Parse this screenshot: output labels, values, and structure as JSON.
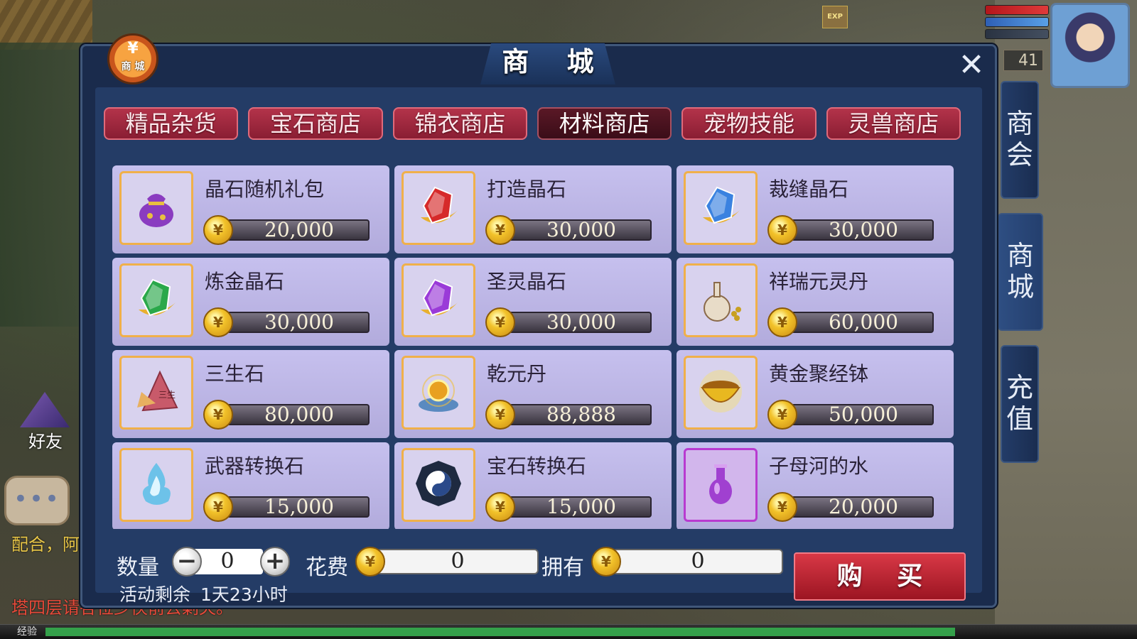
{
  "panel": {
    "title": "商 城",
    "badge_symbol": "¥",
    "badge_label": "商 城",
    "close_symbol": "✕"
  },
  "tabs": [
    {
      "label": "精品杂货",
      "active": false
    },
    {
      "label": "宝石商店",
      "active": false
    },
    {
      "label": "锦衣商店",
      "active": false
    },
    {
      "label": "材料商店",
      "active": true
    },
    {
      "label": "宠物技能",
      "active": false
    },
    {
      "label": "灵兽商店",
      "active": false
    }
  ],
  "items": [
    {
      "name": "晶石随机礼包",
      "price": "20,000",
      "icon": "purple-pouch-icon",
      "color": "#8a3cc0"
    },
    {
      "name": "打造晶石",
      "price": "30,000",
      "icon": "red-crystal-icon",
      "color": "#d62a2a"
    },
    {
      "name": "裁缝晶石",
      "price": "30,000",
      "icon": "blue-snowflake-crystal-icon",
      "color": "#3a82e0"
    },
    {
      "name": "炼金晶石",
      "price": "30,000",
      "icon": "green-crystal-icon",
      "color": "#2aa84a"
    },
    {
      "name": "圣灵晶石",
      "price": "30,000",
      "icon": "purple-lightning-crystal-icon",
      "color": "#9a3ad8"
    },
    {
      "name": "祥瑞元灵丹",
      "price": "60,000",
      "icon": "gourd-bottle-icon",
      "color": "#c8a070"
    },
    {
      "name": "三生石",
      "price": "80,000",
      "icon": "sansheng-stone-icon",
      "color": "#c85a6a"
    },
    {
      "name": "乾元丹",
      "price": "88,888",
      "icon": "golden-orb-icon",
      "color": "#e8a020"
    },
    {
      "name": "黄金聚经钵",
      "price": "50,000",
      "icon": "golden-bowl-icon",
      "color": "#e8b820"
    },
    {
      "name": "武器转换石",
      "price": "15,000",
      "icon": "blue-flame-icon",
      "color": "#5ac0e8"
    },
    {
      "name": "宝石转换石",
      "price": "15,000",
      "icon": "yin-yang-bagua-icon",
      "color": "#2a4a8a"
    },
    {
      "name": "子母河的水",
      "price": "20,000",
      "icon": "purple-vase-icon",
      "color": "#a040d0"
    }
  ],
  "footer": {
    "quantity_label": "数量",
    "quantity_value": "0",
    "minus_symbol": "−",
    "plus_symbol": "+",
    "cost_label": "花费",
    "cost_value": "0",
    "owned_label": "拥有",
    "owned_value": "0",
    "buy_label": "购 买",
    "remain_label": "活动剩余",
    "remain_value": "1天23小时"
  },
  "side_tabs": [
    {
      "label": "商会",
      "active": false
    },
    {
      "label": "商城",
      "active": true
    },
    {
      "label": "充值",
      "active": false
    }
  ],
  "hud": {
    "level": "41",
    "exp_badge": "EXP",
    "friend_label": "好友",
    "chat_more": "•••",
    "chat_line1": "配合，阿",
    "chat_line2": "塔四层请各位少侠前去剿灭。",
    "exp_label": "经验"
  },
  "coin_symbol": "¥"
}
